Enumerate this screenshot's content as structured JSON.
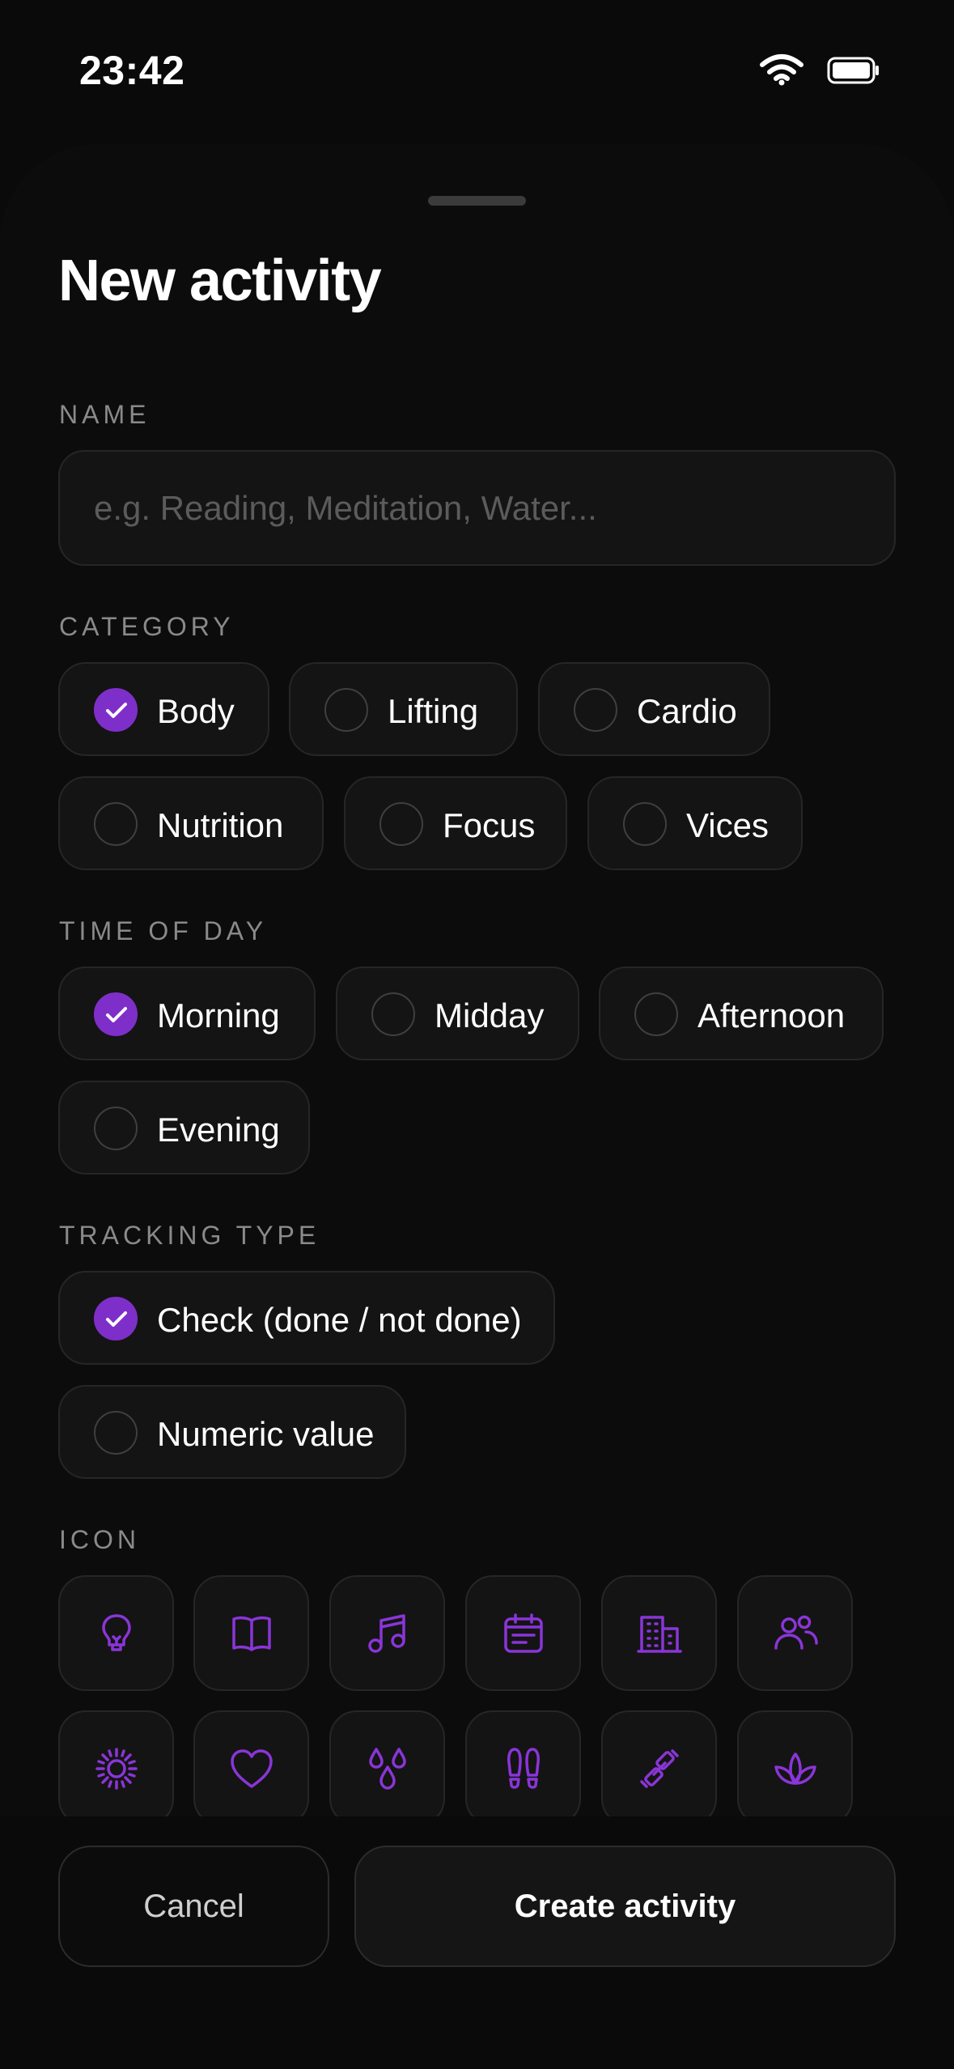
{
  "status_bar": {
    "time": "23:42"
  },
  "sheet": {
    "title": "New activity",
    "name": {
      "label": "NAME",
      "placeholder": "e.g. Reading, Meditation, Water...",
      "value": ""
    },
    "category": {
      "label": "CATEGORY",
      "options": [
        {
          "label": "Body",
          "checked": true
        },
        {
          "label": "Lifting",
          "checked": false
        },
        {
          "label": "Cardio",
          "checked": false
        },
        {
          "label": "Nutrition",
          "checked": false
        },
        {
          "label": "Focus",
          "checked": false
        },
        {
          "label": "Vices",
          "checked": false
        }
      ]
    },
    "time_of_day": {
      "label": "TIME OF DAY",
      "options": [
        {
          "label": "Morning",
          "checked": true
        },
        {
          "label": "Midday",
          "checked": false
        },
        {
          "label": "Afternoon",
          "checked": false
        },
        {
          "label": "Evening",
          "checked": false
        }
      ]
    },
    "tracking_type": {
      "label": "TRACKING TYPE",
      "options": [
        {
          "label": "Check (done / not done)",
          "checked": true
        },
        {
          "label": "Numeric value",
          "checked": false
        }
      ]
    },
    "icon": {
      "label": "ICON",
      "options": [
        "lightbulb-icon",
        "book-icon",
        "music-icon",
        "calendar-icon",
        "building-icon",
        "people-icon",
        "sun-icon",
        "heart-icon",
        "droplets-icon",
        "footprints-icon",
        "dumbbell-icon",
        "lotus-icon"
      ]
    }
  },
  "footer": {
    "cancel_label": "Cancel",
    "create_label": "Create activity"
  },
  "colors": {
    "accent": "#7f2fc9",
    "background": "#0a0a0a",
    "surface": "#141414",
    "border": "#262626",
    "label": "#8a8a8a"
  }
}
